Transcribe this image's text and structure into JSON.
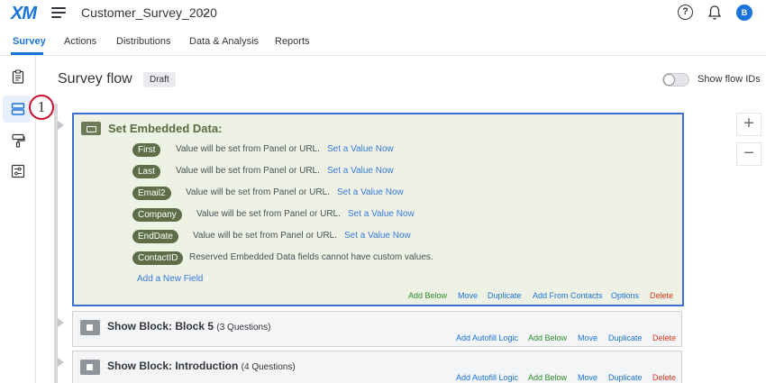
{
  "app": {
    "logo": "XM",
    "project_title": "Customer_Survey_2020",
    "avatar_initial": "B"
  },
  "nav": {
    "tabs": [
      "Survey",
      "Actions",
      "Distributions",
      "Data & Analysis",
      "Reports"
    ],
    "active": "Survey"
  },
  "rail": {
    "icons": [
      "survey-clipboard-icon",
      "survey-flow-icon",
      "look-and-feel-brush-icon",
      "survey-options-icon"
    ],
    "active": "survey-flow-icon",
    "callout_number": "1"
  },
  "header": {
    "title": "Survey flow",
    "status_badge": "Draft",
    "toggle_label": "Show flow IDs",
    "toggle_on": false
  },
  "zoom": {
    "in_label": "+",
    "out_label": "−"
  },
  "embedded_block": {
    "title": "Set Embedded Data:",
    "fields": [
      {
        "name": "First",
        "description": "Value will be set from Panel or URL.",
        "action": "Set a Value Now"
      },
      {
        "name": "Last",
        "description": "Value will be set from Panel or URL.",
        "action": "Set a Value Now"
      },
      {
        "name": "Email2",
        "description": "Value will be set from Panel or URL.",
        "action": "Set a Value Now"
      },
      {
        "name": "Company",
        "description": "Value will be set from Panel or URL.",
        "action": "Set a Value Now"
      },
      {
        "name": "EndDate",
        "description": "Value will be set from Panel or URL.",
        "action": "Set a Value Now"
      },
      {
        "name": "ContactID",
        "description": "Reserved Embedded Data fields cannot have custom values.",
        "action": ""
      }
    ],
    "add_field_label": "Add a New Field",
    "actions": {
      "add_below": "Add Below",
      "move": "Move",
      "duplicate": "Duplicate",
      "add_from_contacts": "Add From Contacts",
      "options": "Options",
      "delete": "Delete"
    }
  },
  "show_blocks": [
    {
      "title": "Show Block: Block 5",
      "count": "(3 Questions)",
      "actions": {
        "autofill": "Add Autofill Logic",
        "add_below": "Add Below",
        "move": "Move",
        "duplicate": "Duplicate",
        "delete": "Delete"
      }
    },
    {
      "title": "Show Block: Introduction",
      "count": "(4 Questions)",
      "actions": {
        "autofill": "Add Autofill Logic",
        "add_below": "Add Below",
        "move": "Move",
        "duplicate": "Duplicate",
        "delete": "Delete"
      }
    }
  ],
  "colors": {
    "brand_blue": "#1a73d8",
    "embedded_bg": "#eef2e4",
    "pill_green": "#5e6e49",
    "selected_border": "#3b6fd1",
    "delete_red": "#d9381e",
    "action_green": "#2d8b2d",
    "callout_red": "#c8102e"
  }
}
